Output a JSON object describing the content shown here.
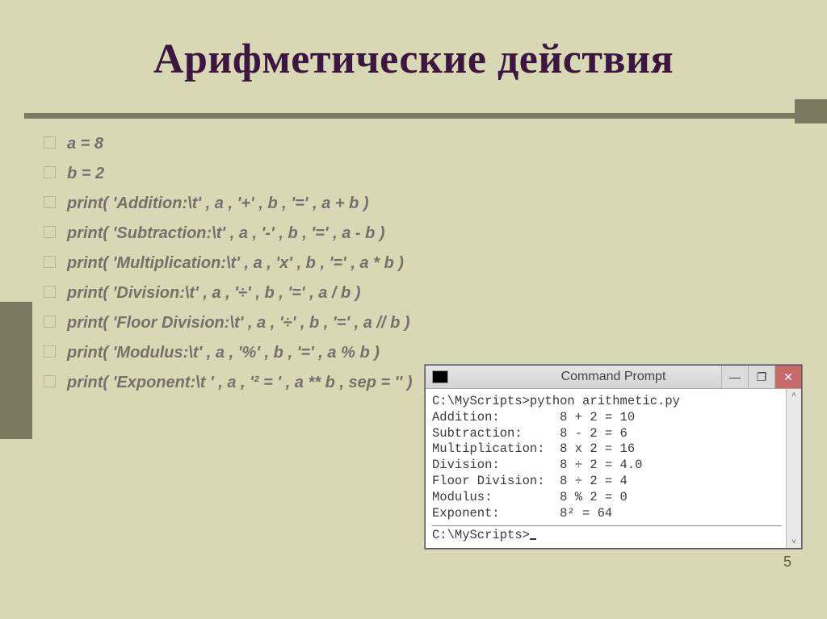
{
  "slide": {
    "title": "Арифметические действия",
    "page_number": "5",
    "bullets": [
      "a = 8",
      "b = 2",
      "print( 'Addition:\\t' , a , '+' , b , '=' , a + b )",
      "print( 'Subtraction:\\t' , a , '-' , b , '=' , a - b )",
      "print( 'Multiplication:\\t' , a , 'x' , b , '=' , a * b )",
      "print( 'Division:\\t' , a , '÷' , b , '=' , a / b )",
      "print( 'Floor Division:\\t' , a , '÷' , b , '=' , a // b )",
      "print( 'Modulus:\\t' , a , '%' , b , '=' , a % b )",
      "print( 'Exponent:\\t ' , a , '² = ' , a ** b , sep = '' )"
    ]
  },
  "cmd": {
    "title": "Command Prompt",
    "buttons": {
      "min": "—",
      "max": "❐",
      "close": "✕"
    },
    "scroll": {
      "up": "˄",
      "down": "˅"
    },
    "lines_top": [
      "C:\\MyScripts>python arithmetic.py",
      "Addition:        8 + 2 = 10",
      "Subtraction:     8 - 2 = 6",
      "Multiplication:  8 x 2 = 16",
      "Division:        8 ÷ 2 = 4.0",
      "Floor Division:  8 ÷ 2 = 4",
      "Modulus:         8 % 2 = 0",
      "Exponent:        8² = 64"
    ],
    "line_bottom": "C:\\MyScripts>"
  }
}
